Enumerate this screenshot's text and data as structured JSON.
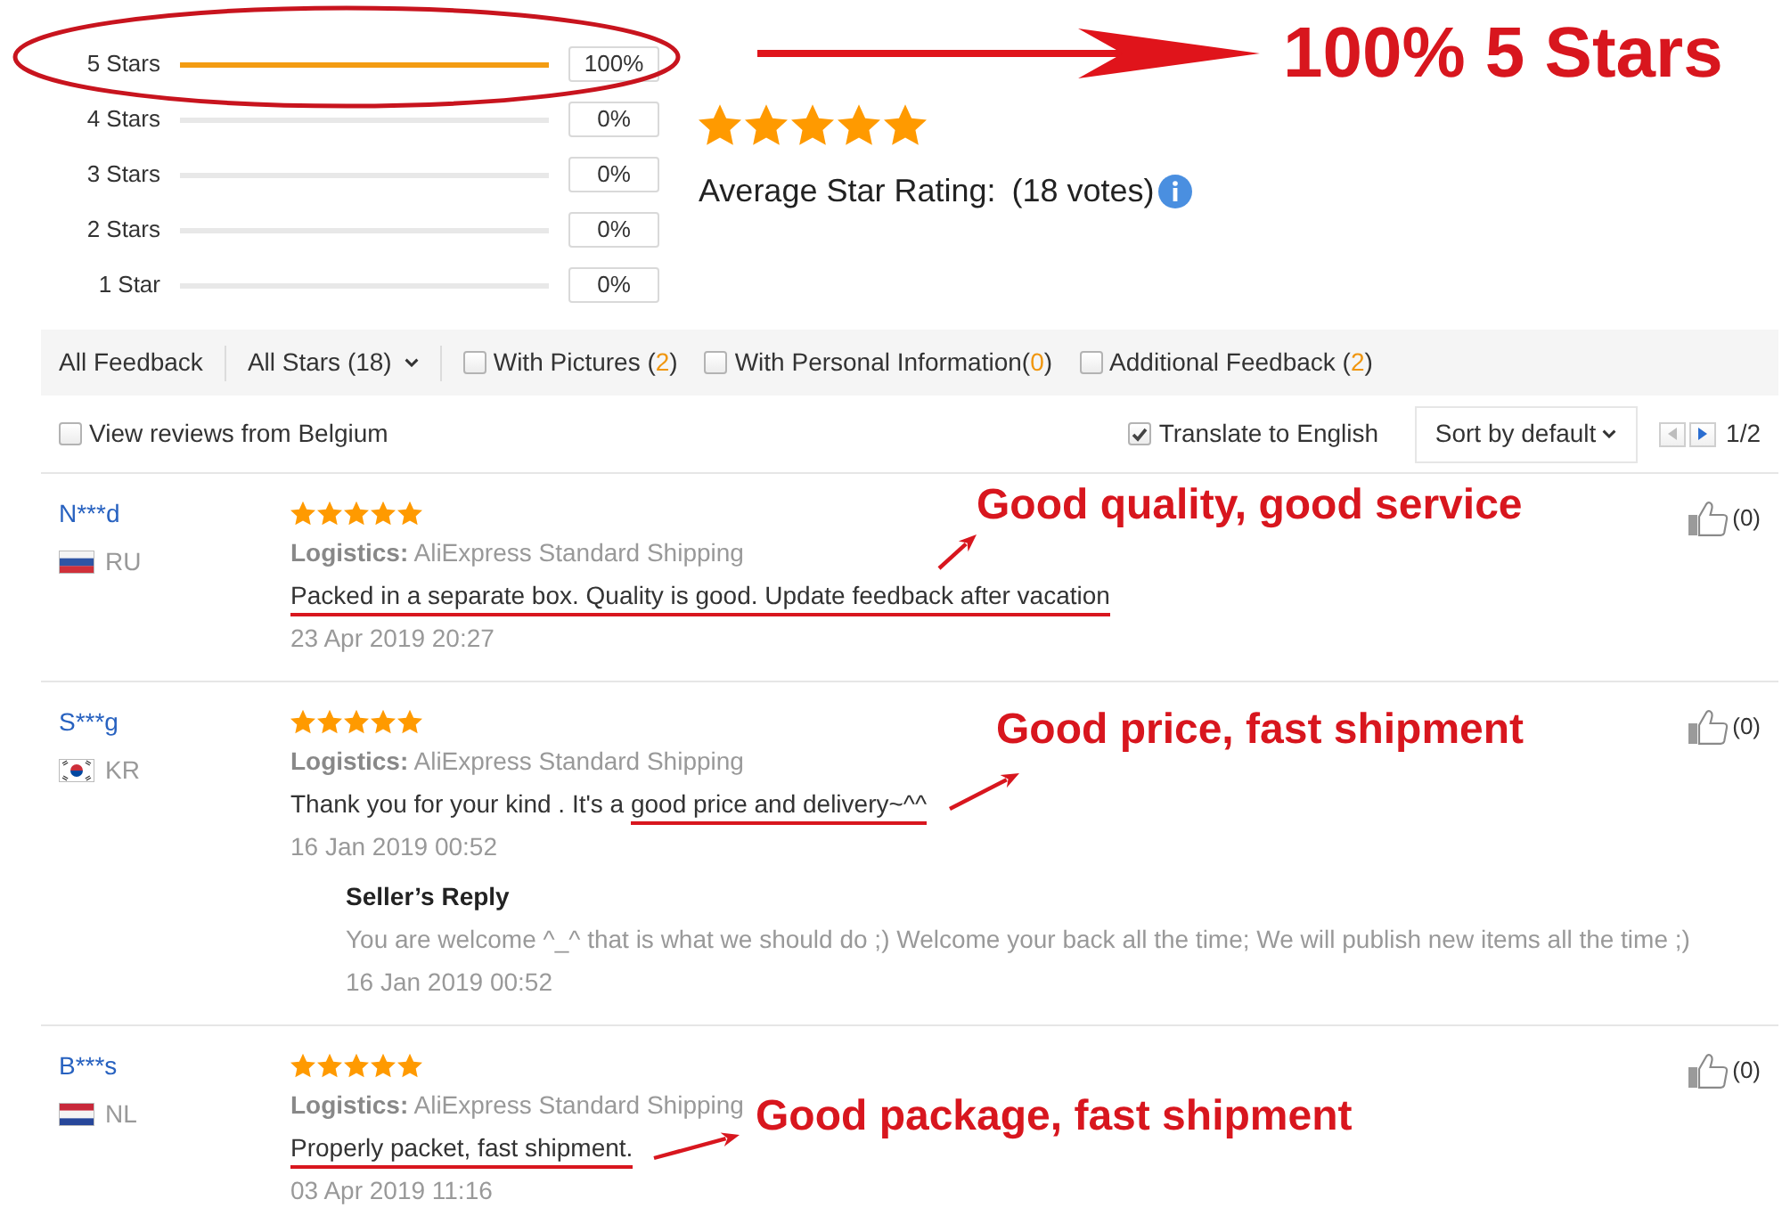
{
  "rating_distribution": [
    {
      "label": "5 Stars",
      "level": 1,
      "percent": "100%",
      "circled": true
    },
    {
      "label": "4 Stars",
      "level": 0,
      "percent": "0%",
      "circled": false
    },
    {
      "label": "3 Stars",
      "level": 0,
      "percent": "0%",
      "circled": false
    },
    {
      "label": "2 Stars",
      "level": 0,
      "percent": "0%",
      "circled": false
    },
    {
      "label": "1 Star",
      "level": 0,
      "percent": "0%",
      "circled": false
    }
  ],
  "callout": {
    "text": "100% 5 Stars"
  },
  "summary": {
    "stars": 5,
    "label": "Average Star Rating:",
    "votes": "(18 votes)"
  },
  "filter_bar": {
    "title": "All Feedback",
    "star_filter": "All Stars (18)",
    "options": [
      {
        "checked": false,
        "label_parts": [
          {
            "text": "With Pictures (",
            "accent": false
          },
          {
            "text": "2",
            "accent": true
          },
          {
            "text": ")",
            "accent": false
          }
        ]
      },
      {
        "checked": false,
        "label_parts": [
          {
            "text": "With Personal Information(",
            "accent": false
          },
          {
            "text": "0",
            "accent": true
          },
          {
            "text": ")",
            "accent": false
          }
        ]
      },
      {
        "checked": false,
        "label_parts": [
          {
            "text": "Additional Feedback (",
            "accent": false
          },
          {
            "text": "2",
            "accent": true
          },
          {
            "text": ")",
            "accent": false
          }
        ]
      }
    ]
  },
  "toolbar": {
    "country_filter": {
      "label": "View reviews from Belgium",
      "checked": false
    },
    "translate": {
      "label": "Translate to English",
      "checked": true
    },
    "sort": "Sort by default",
    "pager": {
      "prev_disabled": true,
      "next_disabled": false,
      "page": "1/2"
    }
  },
  "reviews": [
    {
      "name": "N***d",
      "country": "RU",
      "flag": {
        "kind": "stripes-wbr"
      },
      "stars": 5,
      "logistics": "**Logistics:** AliExpress Standard Shipping",
      "comment": [
        {
          "text": "Packed in a separate box. Quality is good. Update feedback after vacation",
          "underlined": true
        }
      ],
      "date": "23 Apr 2019 20:27",
      "likes": "(0)",
      "annotation": "Good quality, good service"
    },
    {
      "name": "S***g",
      "country": "KR",
      "flag": {
        "kind": "taegeuk"
      },
      "stars": 5,
      "logistics": "**Logistics:** AliExpress Standard Shipping",
      "comment": [
        {
          "text": "Thank you for your kind . It's a ",
          "underlined": false
        },
        {
          "text": "good price and delivery~^^",
          "underlined": true
        }
      ],
      "date": "16 Jan 2019 00:52",
      "likes": "(0)",
      "annotation": "Good price, fast shipment",
      "seller_reply": {
        "title": "Seller’s Reply",
        "text": "You are welcome ^_^ that is what we should do ;) Welcome your back all the time; We will publish new items all the time ;)",
        "date": "16 Jan 2019 00:52"
      }
    },
    {
      "name": "B***s",
      "country": "NL",
      "flag": {
        "kind": "stripes-rwb"
      },
      "stars": 5,
      "logistics": "**Logistics:** AliExpress Standard Shipping",
      "comment": [
        {
          "text": "Properly packet, fast shipment.",
          "underlined": true
        }
      ],
      "date": "03 Apr 2019 11:16",
      "likes": "(0)",
      "annotation": "Good package, fast shipment"
    }
  ]
}
